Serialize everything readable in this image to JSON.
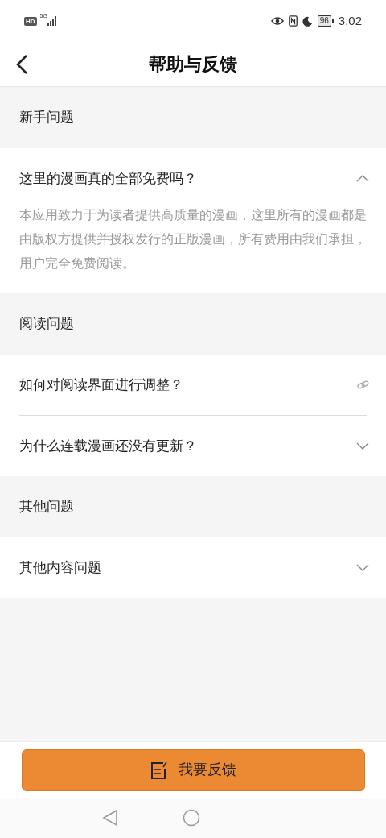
{
  "status_bar": {
    "hd": "HD",
    "network": "5G",
    "battery": "96",
    "time": "3:02"
  },
  "header": {
    "title": "帮助与反馈"
  },
  "sections": [
    {
      "title": "新手问题",
      "items": [
        {
          "kind": "expand",
          "question": "这里的漫画真的全部免费吗？",
          "expanded": true,
          "answer": "本应用致力于为读者提供高质量的漫画，这里所有的漫画都是由版权方提供并授权发行的正版漫画，所有费用由我们承担，用户完全免费阅读。"
        }
      ]
    },
    {
      "title": "阅读问题",
      "items": [
        {
          "kind": "link",
          "question": "如何对阅读界面进行调整？"
        },
        {
          "kind": "expand",
          "question": "为什么连载漫画还没有更新？",
          "expanded": false
        }
      ]
    },
    {
      "title": "其他问题",
      "items": [
        {
          "kind": "expand",
          "question": "其他内容问题",
          "expanded": false
        }
      ]
    }
  ],
  "feedback_button": {
    "label": "我要反馈"
  }
}
